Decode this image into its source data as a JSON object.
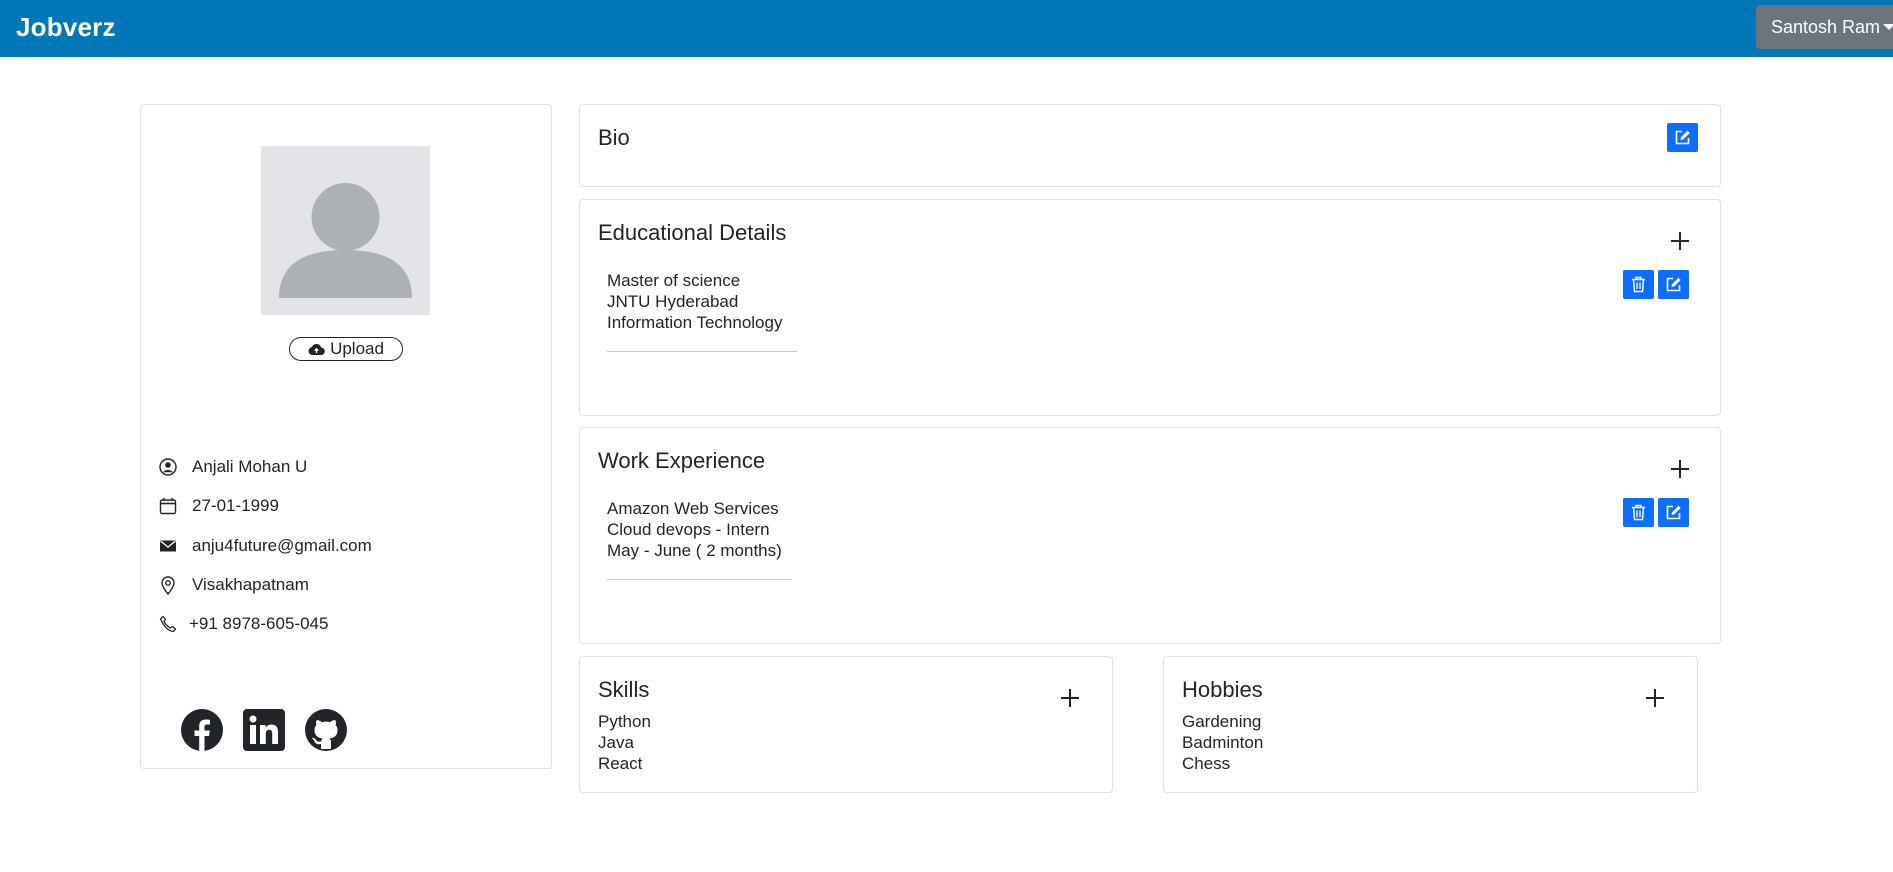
{
  "navbar": {
    "brand": "Jobverz",
    "user_name": "Santosh Ram",
    "brand_color": "#0077b6"
  },
  "profile": {
    "upload_label": "Upload",
    "name": "Anjali Mohan U",
    "dob": "27-01-1999",
    "email": "anju4future@gmail.com",
    "location": "Visakhapatnam",
    "phone": "+91 8978-605-045",
    "social": [
      "facebook-icon",
      "linkedin-icon",
      "github-icon"
    ]
  },
  "bio": {
    "title": "Bio"
  },
  "education": {
    "title": "Educational Details",
    "entries": [
      {
        "degree": "Master of science",
        "institution": "JNTU Hyderabad",
        "field": "Information Technology"
      }
    ]
  },
  "experience": {
    "title": "Work Experience",
    "entries": [
      {
        "company": "Amazon Web Services",
        "role": "Cloud devops - Intern",
        "period": "May - June ( 2 months)"
      }
    ]
  },
  "skills": {
    "title": "Skills",
    "items": [
      "Python",
      "Java",
      "React"
    ]
  },
  "hobbies": {
    "title": "Hobbies",
    "items": [
      "Gardening",
      "Badminton",
      "Chess"
    ]
  },
  "colors": {
    "action_blue": "#0d6efd",
    "user_menu_bg": "#6c757d"
  }
}
